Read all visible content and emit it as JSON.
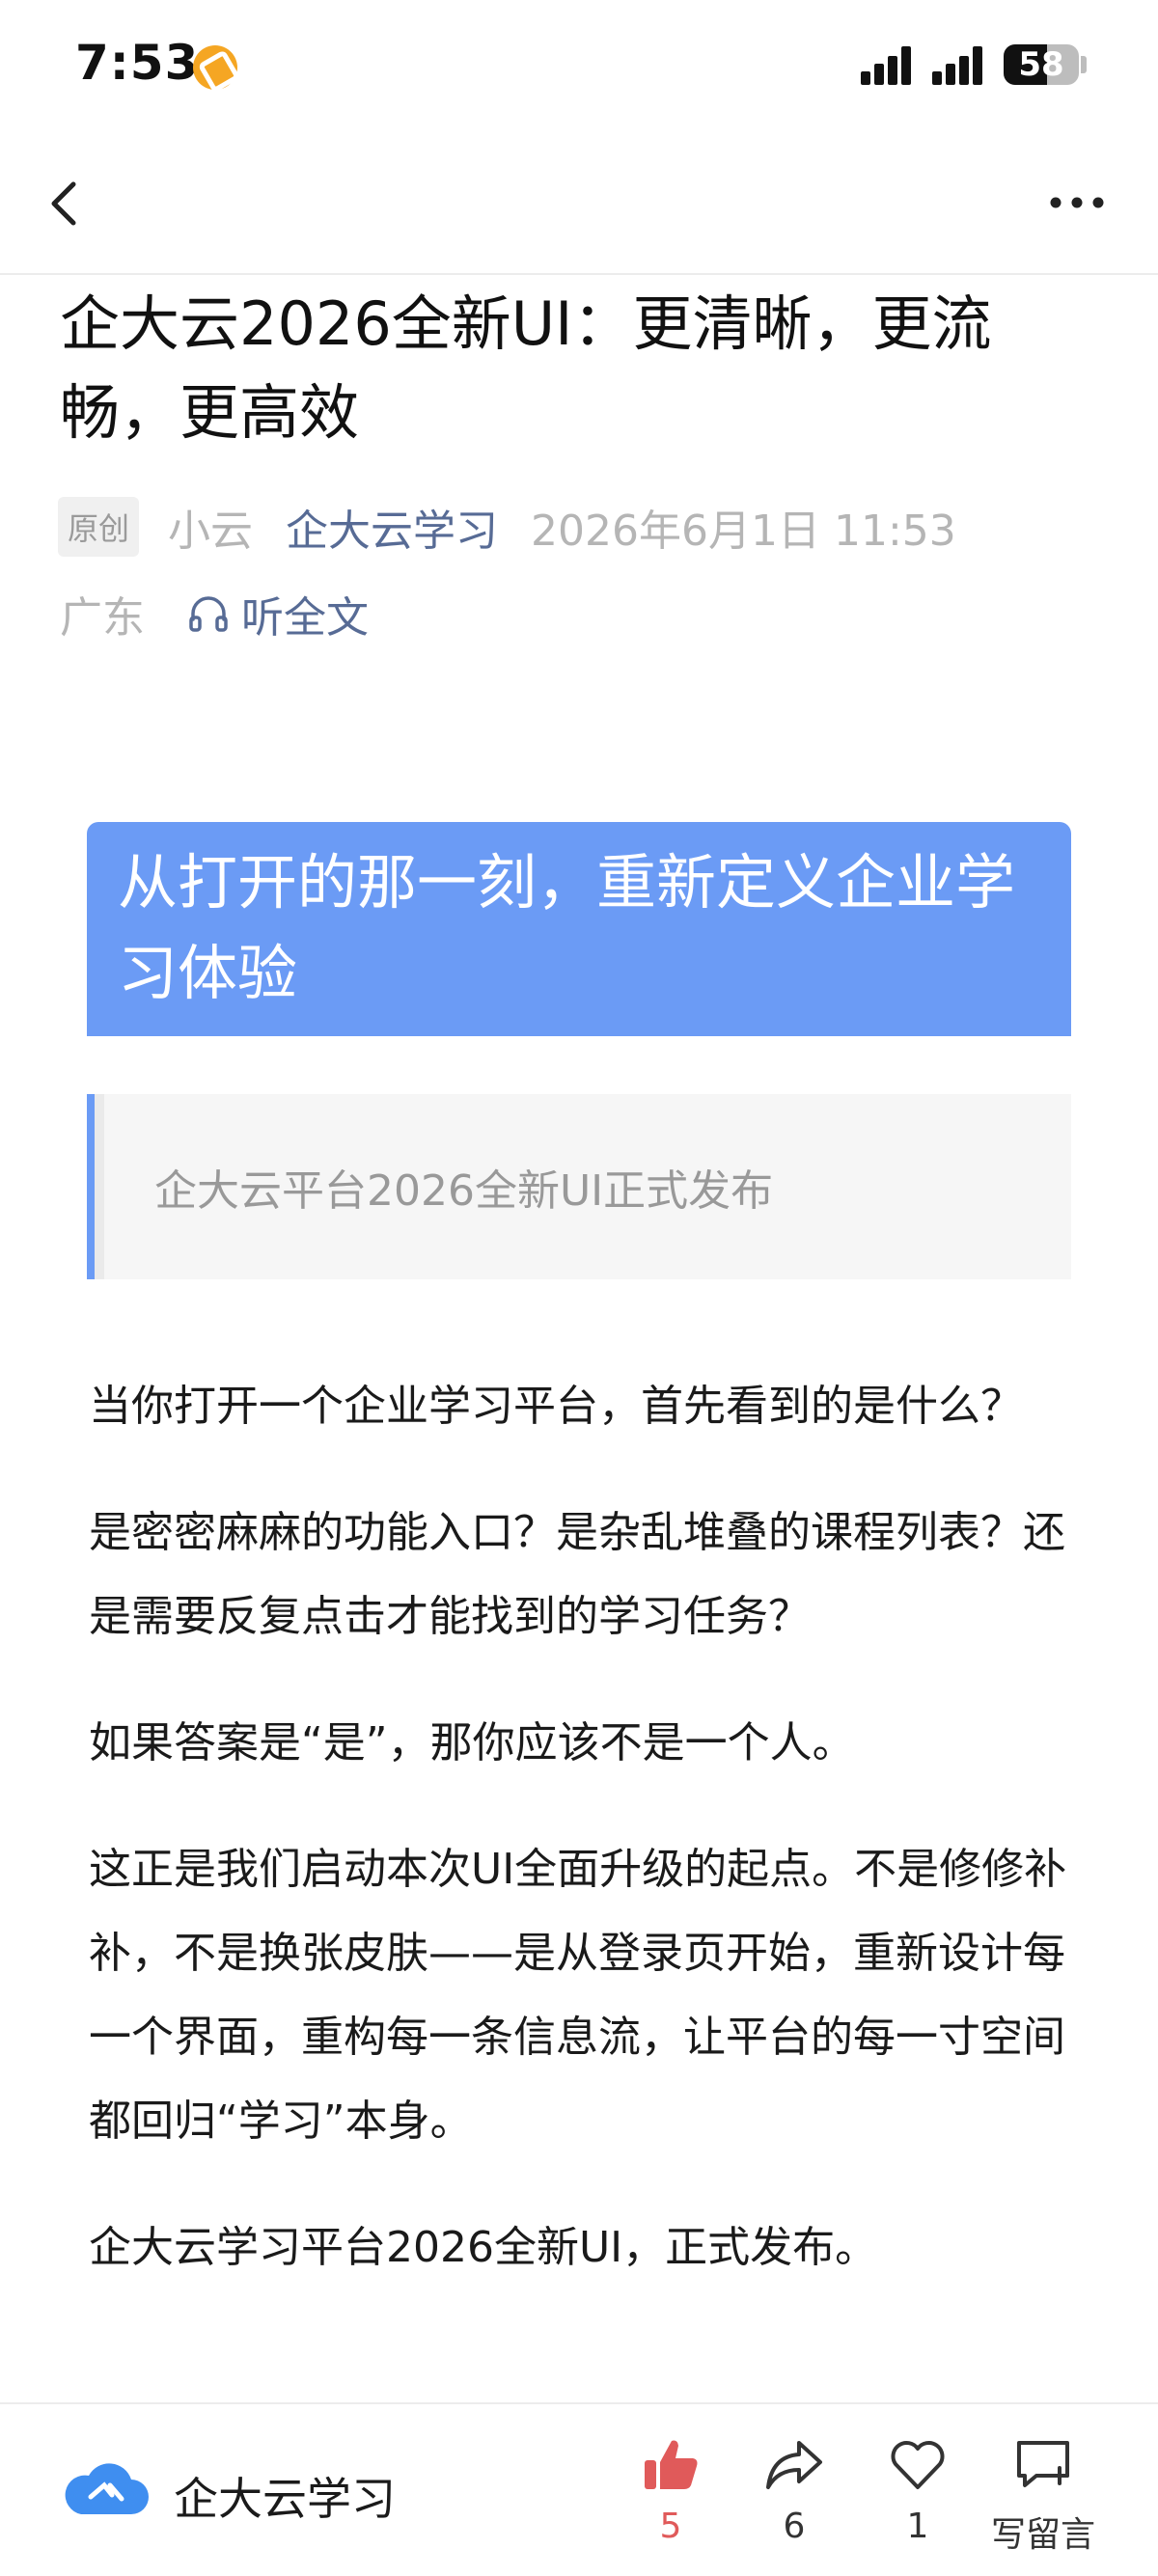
{
  "status_bar": {
    "time": "7:53",
    "battery_level": "58",
    "battery_fraction": 0.58
  },
  "nav": {
    "back_icon": "chevron-left-icon",
    "more_icon": "more-dots-icon"
  },
  "article": {
    "title": "企大云2026全新UI：更清晰，更流畅，更高效",
    "badge": "原创",
    "author": "小云",
    "account": "企大云学习",
    "date": "2026年6月1日 11:53",
    "region": "广东",
    "listen_label": "听全文",
    "hero_text": "从打开的那一刻，重新定义企业学习体验",
    "quote_text": "企大云平台2026全新UI正式发布",
    "paragraphs": [
      "当你打开一个企业学习平台，首先看到的是什么？",
      "是密密麻麻的功能入口？是杂乱堆叠的课程列表？还是需要反复点击才能找到的学习任务？",
      "如果答案是“是”，那你应该不是一个人。",
      "这正是我们启动本次UI全面升级的起点。不是修修补补，不是换张皮肤——是从登录页开始，重新设计每一个界面，重构每一条信息流，让平台的每一寸空间都回归“学习”本身。",
      "企大云学习平台2026全新UI，正式发布。"
    ]
  },
  "bottom_bar": {
    "brand_name": "企大云学习",
    "like_count": "5",
    "share_count": "6",
    "favorite_count": "1",
    "comment_label": "写留言"
  },
  "colors": {
    "accent_blue": "#6b9bf5",
    "link_blue": "#576b95",
    "like_red": "#e05a5a"
  }
}
